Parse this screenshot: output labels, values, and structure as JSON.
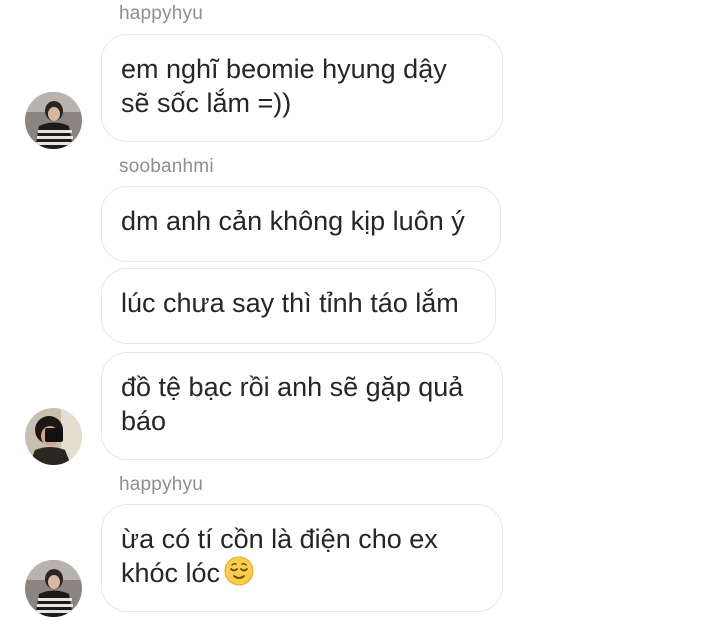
{
  "groups": [
    {
      "sender": "happyhyu",
      "avatar_icon": "profile-photo-striped-sweater",
      "messages": [
        {
          "line1": "em nghĩ beomie hyung dậy",
          "line2": "sẽ sốc lắm =))"
        }
      ]
    },
    {
      "sender": "soobanhmi",
      "avatar_icon": "profile-photo-mirror-selfie",
      "messages": [
        {
          "line1": "dm anh cản không kịp luôn ý"
        },
        {
          "line1": "lúc chưa say thì tỉnh táo lắm"
        },
        {
          "line1": "đồ tệ bạc rồi anh sẽ gặp quả",
          "line2": "báo"
        }
      ]
    },
    {
      "sender": "happyhyu",
      "avatar_icon": "profile-photo-striped-sweater",
      "messages": [
        {
          "line1": "ừa có tí cồn là điện cho ex",
          "line2": "khóc lóc",
          "emoji": "relieved-face-emoji"
        }
      ]
    }
  ],
  "colors": {
    "username": "#8e8e8e",
    "bubble_border": "#e6e6e6",
    "text": "#262626",
    "emoji_yellow": "#ffcc4d"
  }
}
